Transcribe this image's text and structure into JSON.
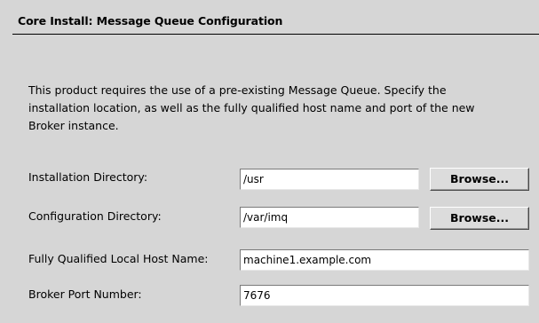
{
  "header": {
    "title": "Core Install:  Message Queue Configuration"
  },
  "description": "This product requires the use of a pre-existing Message Queue.  Specify the installation location, as well as the fully qualified host name and port of the new Broker instance.",
  "fields": {
    "installation_directory": {
      "label": "Installation Directory:",
      "value": "/usr",
      "button": "Browse..."
    },
    "configuration_directory": {
      "label": "Configuration Directory:",
      "value": "/var/imq",
      "button": "Browse..."
    },
    "host_name": {
      "label": "Fully Qualified Local Host Name:",
      "value": "machine1.example.com"
    },
    "broker_port": {
      "label": "Broker Port Number:",
      "value": "7676"
    }
  }
}
